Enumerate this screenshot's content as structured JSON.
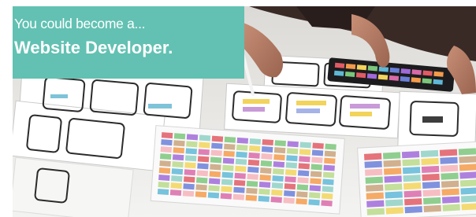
{
  "banner": {
    "intro": "You could become a...",
    "title": "Website Developer."
  },
  "photo": {
    "subject": "wireframe-sketches-and-color-palettes-photo"
  },
  "colors": {
    "caption_box": "#62c1b2",
    "caption_text": "#ffffff"
  }
}
